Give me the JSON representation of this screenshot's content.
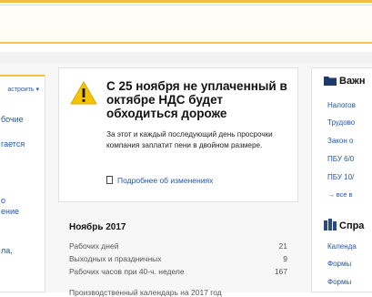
{
  "left": {
    "setup_label": "астроить",
    "links": [
      "бочие",
      "гается",
      "о",
      "ение",
      "ла,"
    ]
  },
  "news": {
    "title": "С 25 ноября не уплаченный в октябре НДС будет обходиться дороже",
    "body": "За этот и каждый последующий день просрочки компания заплатит пени в двойном размере.",
    "link": "Подробнее об изменениях"
  },
  "calendar": {
    "title": "Ноябрь 2017",
    "rows": [
      {
        "label": "Рабочих дней",
        "value": "21"
      },
      {
        "label": "Выходных и праздничных",
        "value": "9"
      },
      {
        "label": "Рабочих часов при 40-ч. неделе",
        "value": "167"
      }
    ],
    "more": "Производственный календарь на 2017 год"
  },
  "right": {
    "section1": {
      "title": "Важн",
      "links": [
        "Налогов",
        "Трудово",
        "Закон о",
        "ПБУ 6/0",
        "ПБУ 10/"
      ],
      "more": "→ все в"
    },
    "section2": {
      "title": "Спра",
      "links": [
        "Календа",
        "Формы",
        "Формы"
      ]
    }
  },
  "colors": {
    "accent_yellow": "#f5c44a",
    "link_blue": "#2255aa",
    "folder_blue": "#1f3a6a"
  }
}
